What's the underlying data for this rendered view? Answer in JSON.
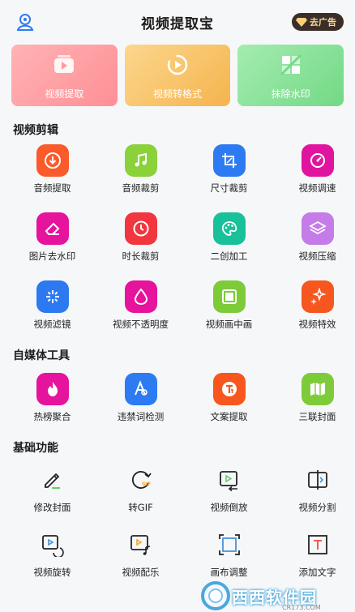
{
  "header": {
    "title": "视频提取宝",
    "ad_label": "去广告"
  },
  "cards": [
    {
      "label": "视频提取",
      "icon": "video-extract-icon"
    },
    {
      "label": "视频转格式",
      "icon": "convert-icon"
    },
    {
      "label": "抹除水印",
      "icon": "erase-watermark-icon"
    }
  ],
  "sections": {
    "video_edit": {
      "title": "视频剪辑",
      "items": [
        {
          "label": "音频提取",
          "color": "#fb5a2a",
          "icon": "download-icon"
        },
        {
          "label": "音频裁剪",
          "color": "#8bd13a",
          "icon": "music-note-icon"
        },
        {
          "label": "尺寸裁剪",
          "color": "#2d7bf3",
          "icon": "crop-icon"
        },
        {
          "label": "视频调速",
          "color": "#e1149f",
          "icon": "speed-icon"
        },
        {
          "label": "图片去水印",
          "color": "#e6139c",
          "icon": "eraser-icon"
        },
        {
          "label": "时长裁剪",
          "color": "#f1363f",
          "icon": "clock-icon"
        },
        {
          "label": "二创加工",
          "color": "#18c19a",
          "icon": "palette-icon"
        },
        {
          "label": "视频压缩",
          "color": "#c57ce8",
          "icon": "layers-icon"
        },
        {
          "label": "视频滤镜",
          "color": "#2c79f0",
          "icon": "sparkle-icon"
        },
        {
          "label": "视频不透明度",
          "color": "#e6139c",
          "icon": "drop-icon"
        },
        {
          "label": "视频画中画",
          "color": "#7ecb3a",
          "icon": "pip-icon"
        },
        {
          "label": "视频特效",
          "color": "#f7561f",
          "icon": "stars-icon"
        }
      ]
    },
    "media_tools": {
      "title": "自媒体工具",
      "items": [
        {
          "label": "热榜聚合",
          "color": "#e6139c",
          "icon": "flame-icon"
        },
        {
          "label": "违禁词检测",
          "color": "#2d7bf3",
          "icon": "text-search-icon"
        },
        {
          "label": "文案提取",
          "color": "#f7561f",
          "icon": "text-extract-icon"
        },
        {
          "label": "三联封面",
          "color": "#7ecb3a",
          "icon": "map-icon"
        }
      ]
    },
    "basic": {
      "title": "基础功能",
      "items": [
        {
          "label": "修改封面",
          "icon": "edit-cover-icon"
        },
        {
          "label": "转GIF",
          "icon": "gif-icon"
        },
        {
          "label": "视频倒放",
          "icon": "reverse-icon"
        },
        {
          "label": "视频分割",
          "icon": "split-icon"
        },
        {
          "label": "视频旋转",
          "icon": "rotate-icon"
        },
        {
          "label": "视频配乐",
          "icon": "music-video-icon"
        },
        {
          "label": "画布调整",
          "icon": "canvas-icon"
        },
        {
          "label": "添加文字",
          "icon": "add-text-icon"
        }
      ]
    }
  },
  "watermark": {
    "text": "西西软件园",
    "sub": "CR173.COM"
  }
}
